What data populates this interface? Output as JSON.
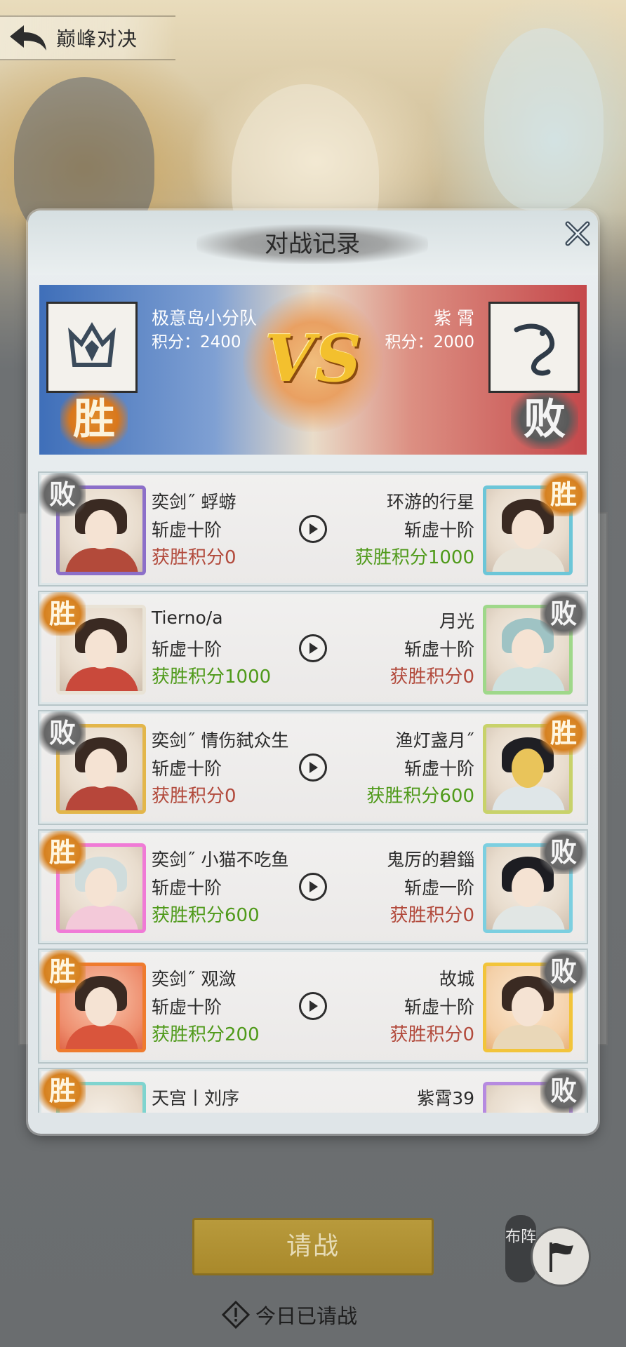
{
  "header": {
    "title": "巅峰对决"
  },
  "dialog": {
    "title": "对战记录"
  },
  "versus": {
    "vs_text": "VS",
    "left": {
      "name": "极意岛小分队",
      "score": "积分：2400",
      "result": "胜"
    },
    "right": {
      "name": "紫 霄",
      "score": "积分：2000",
      "result": "败"
    }
  },
  "matches": [
    {
      "left": {
        "name": "奕剑˝ 蜉蝣",
        "rank": "斩虚十阶",
        "points": "获胜积分0",
        "result": "败"
      },
      "right": {
        "name": "环游的行星",
        "rank": "斩虚十阶",
        "points": "获胜积分1000",
        "result": "胜"
      }
    },
    {
      "left": {
        "name": "Tierno/a",
        "rank": "斩虚十阶",
        "points": "获胜积分1000",
        "result": "胜"
      },
      "right": {
        "name": "月光",
        "rank": "斩虚十阶",
        "points": "获胜积分0",
        "result": "败"
      }
    },
    {
      "left": {
        "name": "奕剑˝ 情伤弑众生",
        "rank": "斩虚十阶",
        "points": "获胜积分0",
        "result": "败"
      },
      "right": {
        "name": "渔灯盏月˝",
        "rank": "斩虚十阶",
        "points": "获胜积分600",
        "result": "胜"
      }
    },
    {
      "left": {
        "name": "奕剑˝ 小猫不吃鱼",
        "rank": "斩虚十阶",
        "points": "获胜积分600",
        "result": "胜"
      },
      "right": {
        "name": "鬼厉的碧錙",
        "rank": "斩虚一阶",
        "points": "获胜积分0",
        "result": "败"
      }
    },
    {
      "left": {
        "name": "奕剑˝ 观潋",
        "rank": "斩虚十阶",
        "points": "获胜积分200",
        "result": "胜"
      },
      "right": {
        "name": "故城",
        "rank": "斩虚十阶",
        "points": "获胜积分0",
        "result": "败"
      }
    },
    {
      "left": {
        "name": "天宫丨刘序",
        "result": "胜"
      },
      "right": {
        "name": "紫霄39",
        "result": "败"
      }
    }
  ],
  "footer": {
    "challenge_label": "请战",
    "status_text": "今日已请战",
    "formation_label": "布阵"
  },
  "colors": {
    "win_green": "#4f9a1a",
    "loss_red": "#b24a3c",
    "gold": "#caa64a"
  }
}
